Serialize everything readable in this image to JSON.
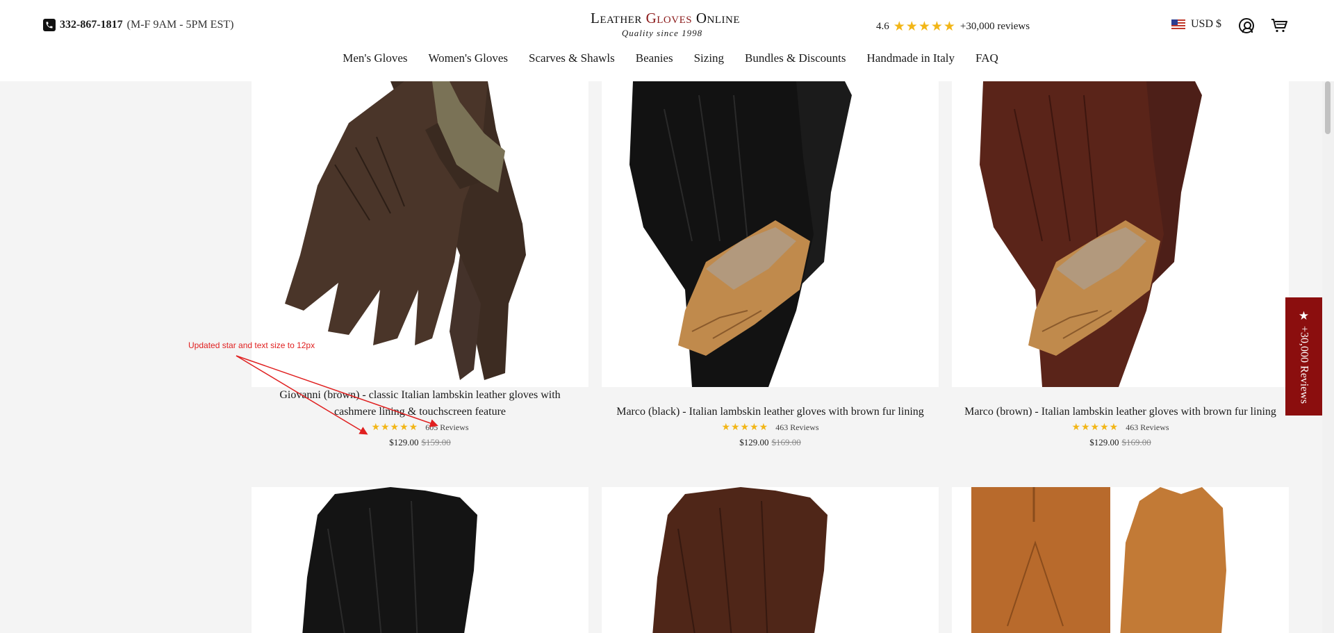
{
  "header": {
    "phone_number": "332-867-1817",
    "phone_hours": "(M-F 9AM - 5PM EST)",
    "logo_part1": "Leather ",
    "logo_accent": "Gloves",
    "logo_part2": " Online",
    "logo_tagline": "Quality since 1998",
    "rating_value": "4.6",
    "rating_stars": "★★★★★",
    "rating_count": "+30,000 reviews",
    "currency": "USD $"
  },
  "nav": {
    "items": [
      "Men's Gloves",
      "Women's Gloves",
      "Scarves & Shawls",
      "Beanies",
      "Sizing",
      "Bundles & Discounts",
      "Handmade in Italy",
      "FAQ"
    ]
  },
  "products": [
    {
      "title": "Giovanni (brown) - classic Italian lambskin leather gloves with cashmere lining & touchscreen feature",
      "stars": "★★★★★",
      "reviews": "605 Reviews",
      "price": "$129.00",
      "old_price": "$159.00"
    },
    {
      "title": "Marco (black) - Italian lambskin leather gloves with brown fur lining",
      "stars": "★★★★★",
      "reviews": "463 Reviews",
      "price": "$129.00",
      "old_price": "$169.00"
    },
    {
      "title": "Marco (brown) - Italian lambskin leather gloves with brown fur lining",
      "stars": "★★★★★",
      "reviews": "463 Reviews",
      "price": "$129.00",
      "old_price": "$169.00"
    }
  ],
  "annotation": {
    "text": "Updated star and text size to 12px"
  },
  "reviews_tab": {
    "star": "★",
    "label": "+30,000 Reviews"
  },
  "colors": {
    "brand_red": "#8b0e0e",
    "star_gold": "#f2b617",
    "annotation_red": "#e02020"
  },
  "icons": [
    "phone-icon",
    "flag-us-icon",
    "account-icon",
    "cart-icon",
    "star-icon"
  ]
}
